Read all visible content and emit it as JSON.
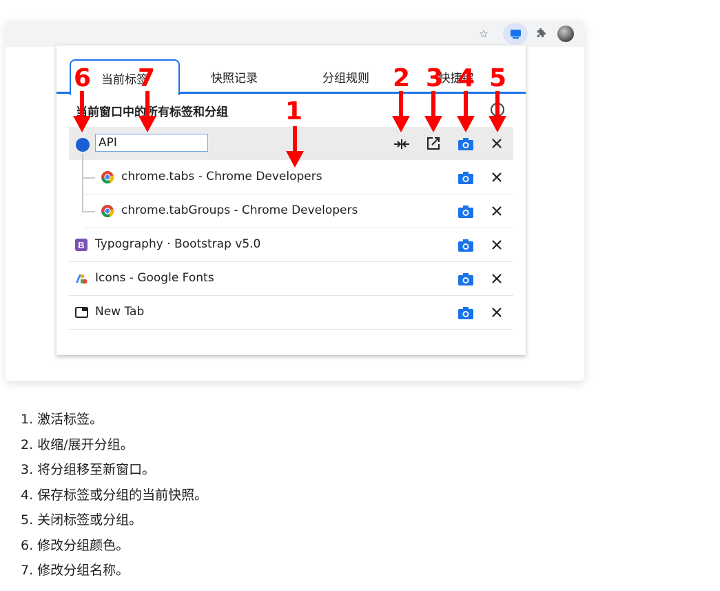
{
  "popup": {
    "tabs": [
      "当前标签",
      "快照记录",
      "分组规则",
      "快捷键"
    ],
    "section_title": "当前窗口中的所有标签和分组",
    "group": {
      "name": "API",
      "color": "#1a5fd6"
    },
    "group_tabs": [
      {
        "title": "chrome.tabs - Chrome Developers",
        "favicon": "chrome-icon"
      },
      {
        "title": "chrome.tabGroups - Chrome Developers",
        "favicon": "chrome-icon"
      }
    ],
    "tabs_list": [
      {
        "title": "Typography · Bootstrap v5.0",
        "favicon": "bootstrap-icon"
      },
      {
        "title": "Icons - Google Fonts",
        "favicon": "google-fonts-icon"
      },
      {
        "title": "New Tab",
        "favicon": "new-tab-icon"
      }
    ]
  },
  "annotations": [
    "1",
    "2",
    "3",
    "4",
    "5",
    "6",
    "7"
  ],
  "descriptions": [
    "1. 激活标签。",
    "2. 收缩/展开分组。",
    "3. 将分组移至新窗口。",
    "4. 保存标签或分组的当前快照。",
    "5. 关闭标签或分组。",
    "6. 修改分组颜色。",
    "7. 修改分组名称。"
  ],
  "colors": {
    "accent": "#1a73e8",
    "annotation": "#ff0000"
  }
}
